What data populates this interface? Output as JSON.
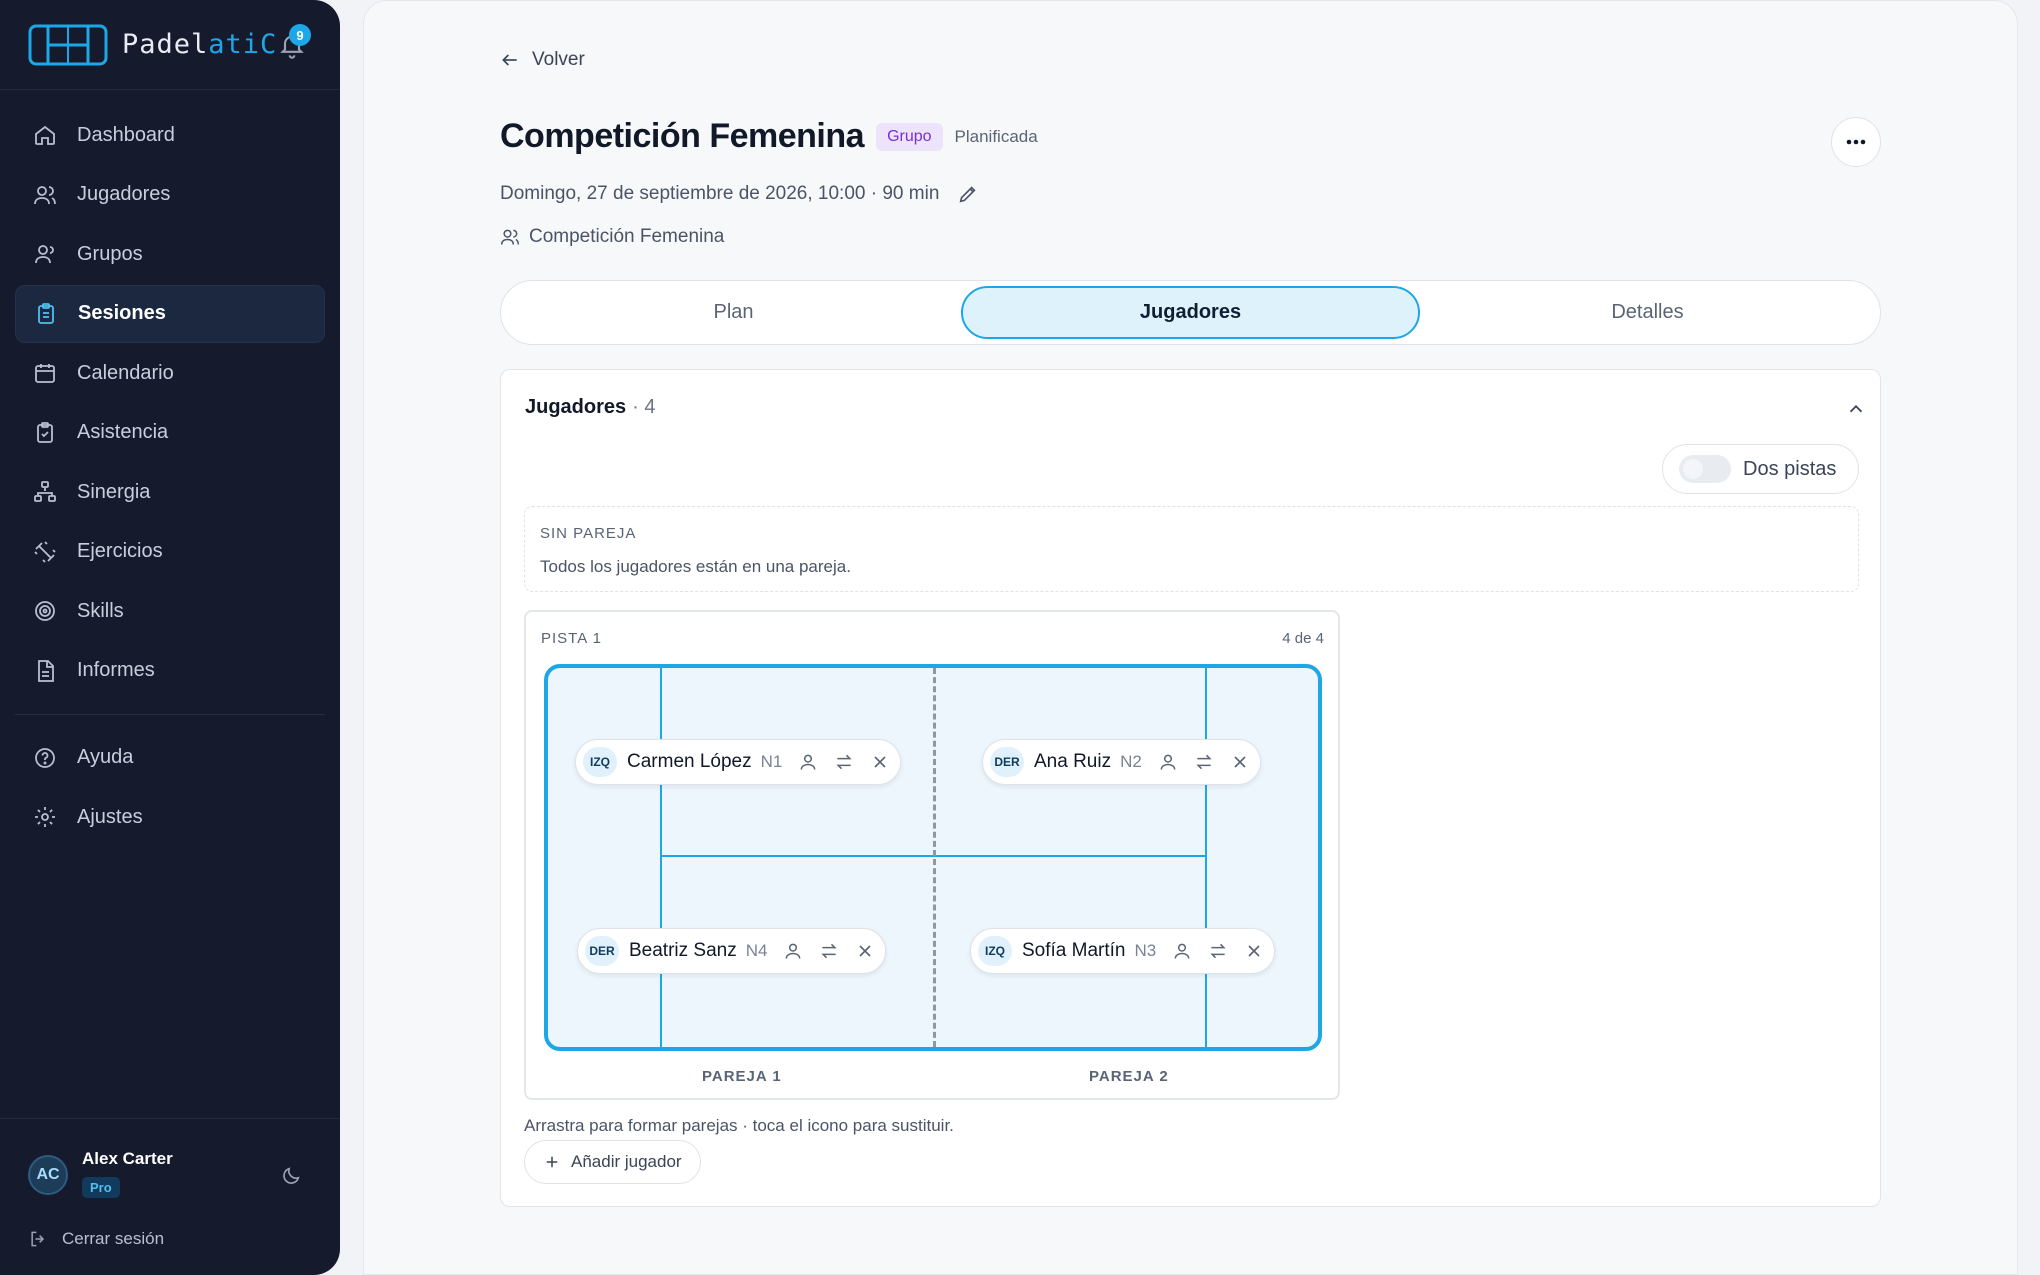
{
  "app": {
    "brand_main": "Padel",
    "brand_accent": "atiC",
    "notification_count": "9"
  },
  "sidebar": {
    "items": [
      {
        "label": "Dashboard",
        "icon": "home-icon"
      },
      {
        "label": "Jugadores",
        "icon": "users-icon"
      },
      {
        "label": "Grupos",
        "icon": "group-icon"
      },
      {
        "label": "Sesiones",
        "icon": "clipboard-icon",
        "active": true
      },
      {
        "label": "Calendario",
        "icon": "calendar-icon"
      },
      {
        "label": "Asistencia",
        "icon": "clipboard-check-icon"
      },
      {
        "label": "Sinergia",
        "icon": "network-icon"
      },
      {
        "label": "Ejercicios",
        "icon": "dumbbell-icon"
      },
      {
        "label": "Skills",
        "icon": "target-icon"
      },
      {
        "label": "Informes",
        "icon": "file-icon"
      }
    ],
    "secondary": [
      {
        "label": "Ayuda",
        "icon": "help-icon"
      },
      {
        "label": "Ajustes",
        "icon": "gear-icon"
      }
    ],
    "user": {
      "initials": "AC",
      "name": "Alex Carter",
      "plan": "Pro"
    },
    "logout_label": "Cerrar sesión"
  },
  "page": {
    "back_label": "Volver",
    "title": "Competición Femenina",
    "type_badge": "Grupo",
    "status": "Planificada",
    "date_line": "Domingo, 27 de septiembe de 2026, 10:00 · 90 min",
    "group_name": "Competición Femenina"
  },
  "tabs": [
    {
      "label": "Plan"
    },
    {
      "label": "Jugadores",
      "active": true
    },
    {
      "label": "Detalles"
    }
  ],
  "players_section": {
    "title": "Jugadores",
    "count": "· 4",
    "toggle_label": "Dos pistas",
    "toggle_on": false,
    "unpaired_title": "SIN PAREJA",
    "unpaired_desc": "Todos los jugadores están en una pareja.",
    "court_label": "PISTA 1",
    "court_count": "4 de 4",
    "players": [
      {
        "side": "IZQ",
        "name": "Carmen López",
        "level": "N1"
      },
      {
        "side": "DER",
        "name": "Ana Ruiz",
        "level": "N2"
      },
      {
        "side": "DER",
        "name": "Beatriz Sanz",
        "level": "N4"
      },
      {
        "side": "IZQ",
        "name": "Sofía Martín",
        "level": "N3"
      }
    ],
    "pair_labels": [
      "PAREJA 1",
      "PAREJA 2"
    ],
    "hint": "Arrastra para formar parejas · toca el icono para sustituir.",
    "add_label": "Añadir jugador"
  },
  "colors": {
    "accent": "#1ea7e6",
    "sidebar_bg": "#151b2c",
    "badge_purple": "#7b2fd6"
  }
}
